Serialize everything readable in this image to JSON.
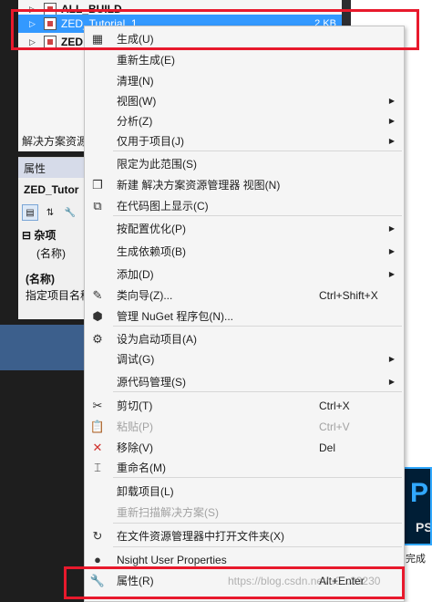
{
  "solution_explorer": {
    "rows": [
      {
        "label": "ALL_BUILD"
      },
      {
        "label": "ZED_Tutorial_1",
        "size": "2 KB"
      },
      {
        "label": "ZED"
      }
    ],
    "footer": "解决方案资源"
  },
  "properties": {
    "title": "属性",
    "object": "ZED_Tutor",
    "category": "杂项",
    "name_row": "(名称)",
    "desc_title": "(名称)",
    "desc": "指定项目名称"
  },
  "ps_tile": {
    "letter": "P",
    "sub": "PS",
    "caption": "完成"
  },
  "menu": {
    "items": [
      {
        "label": "生成(U)",
        "icon": "build-icon",
        "glyph": "▦"
      },
      {
        "label": "重新生成(E)"
      },
      {
        "label": "清理(N)"
      },
      {
        "label": "视图(W)",
        "submenu": true
      },
      {
        "label": "分析(Z)",
        "submenu": true
      },
      {
        "label": "仅用于项目(J)",
        "submenu": true
      },
      {
        "label": "限定为此范围(S)"
      },
      {
        "label": "新建 解决方案资源管理器 视图(N)",
        "icon": "new-view-icon",
        "glyph": "❐"
      },
      {
        "label": "在代码图上显示(C)",
        "icon": "code-map-icon",
        "glyph": "⧉"
      },
      {
        "label": "按配置优化(P)",
        "submenu": true
      },
      {
        "label": "生成依赖项(B)",
        "submenu": true
      },
      {
        "label": "添加(D)",
        "submenu": true
      },
      {
        "label": "类向导(Z)...",
        "shortcut": "Ctrl+Shift+X",
        "icon": "class-wizard-icon",
        "glyph": "✎"
      },
      {
        "label": "管理 NuGet 程序包(N)...",
        "icon": "nuget-icon",
        "glyph": "⬢"
      },
      {
        "label": "设为启动项目(A)",
        "icon": "gear-icon",
        "glyph": "⚙"
      },
      {
        "label": "调试(G)",
        "submenu": true
      },
      {
        "label": "源代码管理(S)",
        "submenu": true
      },
      {
        "label": "剪切(T)",
        "shortcut": "Ctrl+X",
        "icon": "scissors-icon",
        "glyph": "✂"
      },
      {
        "label": "粘贴(P)",
        "shortcut": "Ctrl+V",
        "icon": "paste-icon",
        "glyph": "📋",
        "disabled": true
      },
      {
        "label": "移除(V)",
        "shortcut": "Del",
        "icon": "delete-icon",
        "glyph": "✕",
        "icon_color": "#d0312d"
      },
      {
        "label": "重命名(M)",
        "icon": "rename-icon",
        "glyph": "⌶"
      },
      {
        "label": "卸载项目(L)"
      },
      {
        "label": "重新扫描解决方案(S)",
        "disabled": true
      },
      {
        "label": "在文件资源管理器中打开文件夹(X)",
        "icon": "refresh-arrow-icon",
        "glyph": "↻"
      },
      {
        "label": "Nsight User Properties",
        "icon": "nsight-icon",
        "glyph": "●"
      },
      {
        "label": "属性(R)",
        "shortcut": "Alt+Enter",
        "icon": "wrench-icon",
        "glyph": "🔧"
      }
    ]
  },
  "watermark": "https://blog.csdn.net/u0...33230"
}
